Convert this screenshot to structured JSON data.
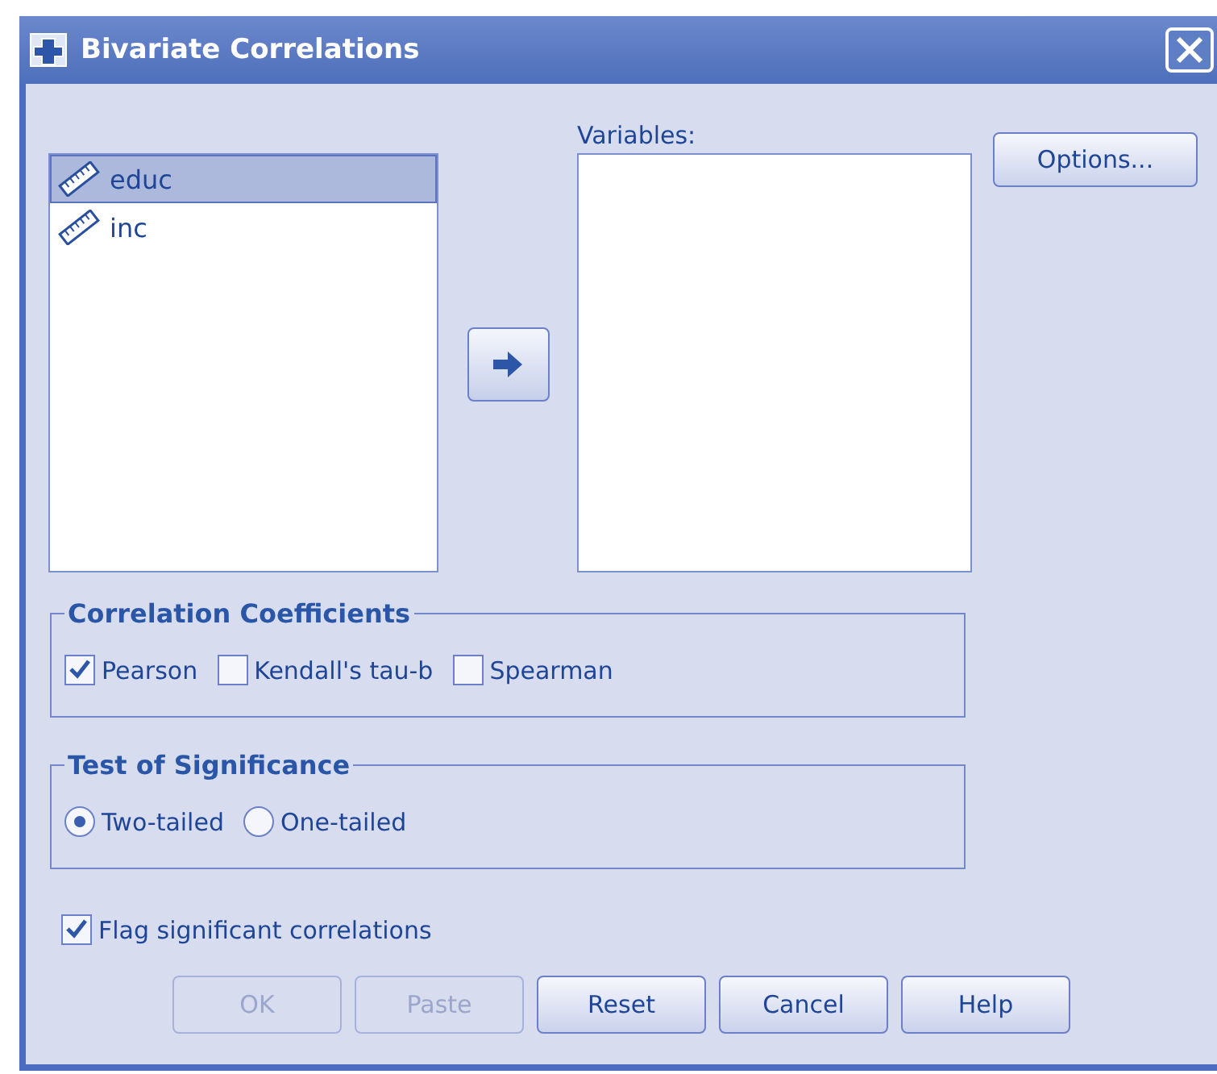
{
  "window": {
    "title": "Bivariate Correlations"
  },
  "source_list": {
    "items": [
      {
        "label": "educ",
        "selected": true
      },
      {
        "label": "inc",
        "selected": false
      }
    ]
  },
  "variables": {
    "label": "Variables:"
  },
  "options_button": "Options...",
  "correlation_coefficients": {
    "title": "Correlation Coefficients",
    "options": [
      {
        "label": "Pearson",
        "checked": true
      },
      {
        "label": "Kendall's tau-b",
        "checked": false
      },
      {
        "label": "Spearman",
        "checked": false
      }
    ]
  },
  "test_of_significance": {
    "title": "Test of Significance",
    "options": [
      {
        "label": "Two-tailed",
        "selected": true
      },
      {
        "label": "One-tailed",
        "selected": false
      }
    ]
  },
  "flag_significant": {
    "label": "Flag significant correlations",
    "checked": true
  },
  "buttons": [
    {
      "label": "OK",
      "disabled": true
    },
    {
      "label": "Paste",
      "disabled": true
    },
    {
      "label": "Reset",
      "disabled": false
    },
    {
      "label": "Cancel",
      "disabled": false
    },
    {
      "label": "Help",
      "disabled": false
    }
  ]
}
